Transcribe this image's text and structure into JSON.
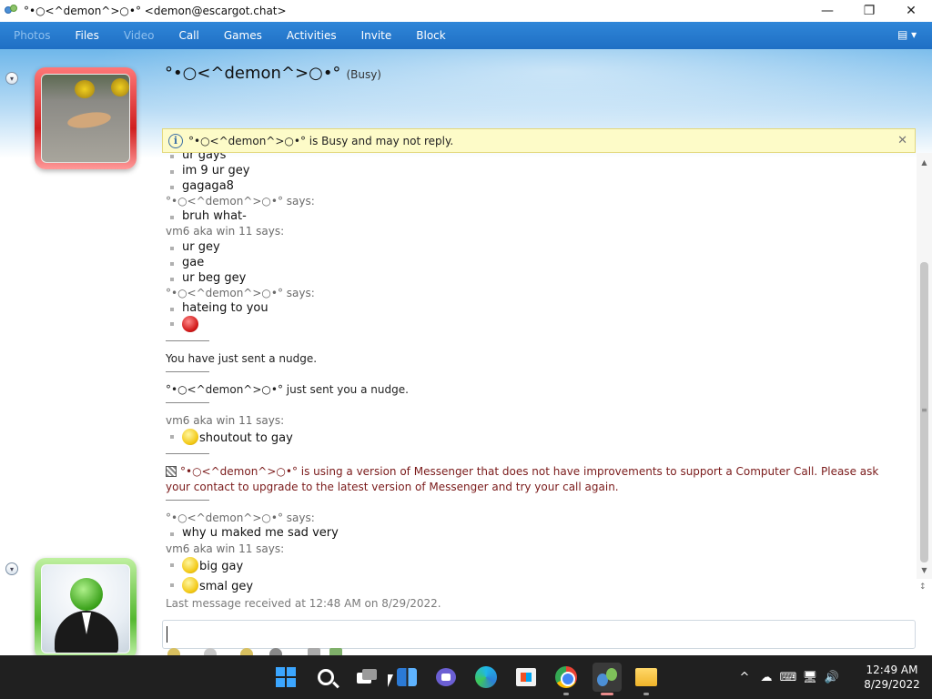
{
  "window": {
    "title": "°•○<^demon^>○•° <demon@escargot.chat>",
    "minimize": "—",
    "maximize": "❐",
    "close": "✕"
  },
  "menu": {
    "items": [
      {
        "label": "Photos",
        "enabled": false
      },
      {
        "label": "Files",
        "enabled": true
      },
      {
        "label": "Video",
        "enabled": false
      },
      {
        "label": "Call",
        "enabled": true
      },
      {
        "label": "Games",
        "enabled": true
      },
      {
        "label": "Activities",
        "enabled": true
      },
      {
        "label": "Invite",
        "enabled": true
      },
      {
        "label": "Block",
        "enabled": true
      }
    ],
    "tool_glyph": "▤ ▾"
  },
  "contact": {
    "name": "°•○<^demon^>○•°",
    "status": "(Busy)"
  },
  "infobar": {
    "text": "°•○<^demon^>○•° is Busy and may not reply.",
    "close": "✕"
  },
  "conversation": {
    "l1": "ur gays",
    "l2": "im 9 ur gey",
    "l3": "gagaga8",
    "l4": "°•○<^demon^>○•° says:",
    "l5": "bruh what-",
    "l6": "vm6 aka win 11 says:",
    "l7": "ur gey",
    "l8": "gae",
    "l9": "ur beg gey",
    "l10": "°•○<^demon^>○•° says:",
    "l11": "hateing to you",
    "l12": "You have just sent a nudge.",
    "l13": "°•○<^demon^>○•° just sent you a nudge.",
    "l14": "vm6 aka win 11 says:",
    "l15": "shoutout to gay",
    "l16": "°•○<^demon^>○•° is using a version of Messenger that does not have improvements to support a Computer Call.  Please ask your contact to upgrade to the latest version of Messenger and try your call again.",
    "l17": "°•○<^demon^>○•° says:",
    "l18": "why u maked me sad very",
    "l19": "vm6 aka win 11 says:",
    "l20": "big gay",
    "l21": "smal gey",
    "last_received": "Last message received at 12:48 AM on 8/29/2022."
  },
  "taskbar": {
    "clock_time": "12:49 AM",
    "clock_date": "8/29/2022",
    "tray": [
      "^",
      "☁",
      "⌨",
      "🖥",
      "🔊"
    ]
  },
  "colors": {
    "menubar": "#2f86d8",
    "busy_frame": "#d02020",
    "online_frame": "#55b830",
    "warning_text": "#7a1a1a"
  }
}
